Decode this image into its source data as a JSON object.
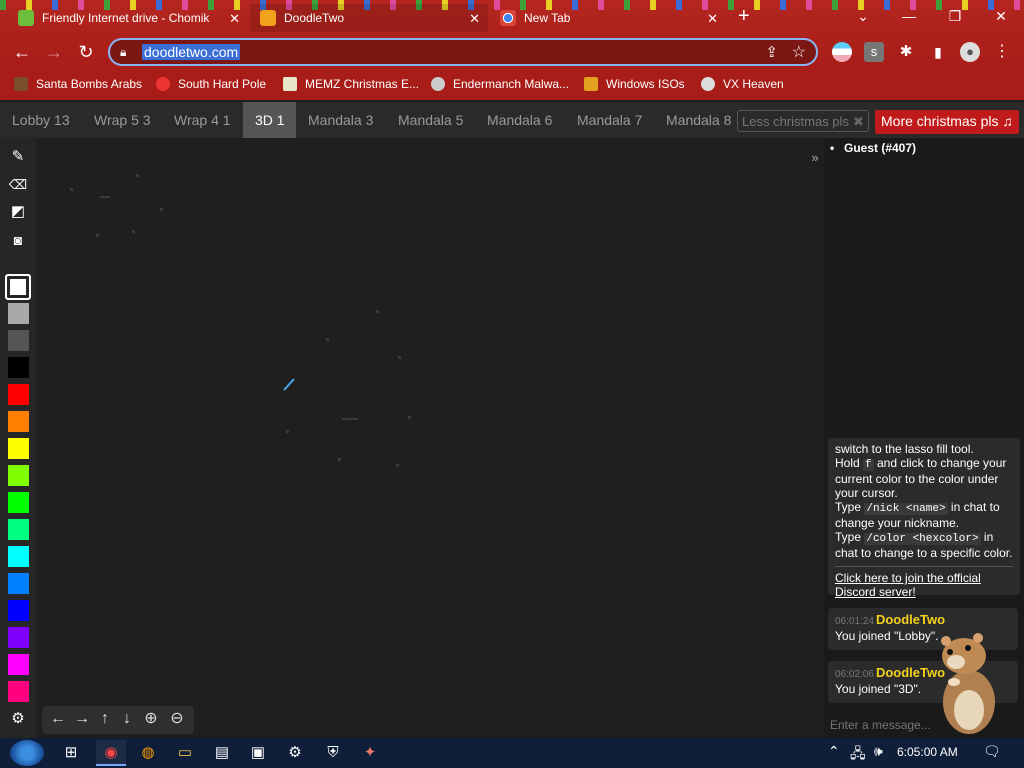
{
  "browser": {
    "tabs": [
      {
        "title": "Friendly Internet drive - Chomik",
        "active": false
      },
      {
        "title": "DoodleTwo",
        "active": true
      },
      {
        "title": "New Tab",
        "active": false
      }
    ],
    "url": "doodletwo.com",
    "bookmarks": [
      {
        "label": "Santa Bombs Arabs"
      },
      {
        "label": "South Hard Pole"
      },
      {
        "label": "MEMZ Christmas E..."
      },
      {
        "label": "Endermanch Malwa..."
      },
      {
        "label": "Windows ISOs"
      },
      {
        "label": "VX Heaven"
      }
    ],
    "extension_s_label": "s"
  },
  "rooms": [
    {
      "label": "Lobby 13",
      "active": false
    },
    {
      "label": "Wrap 5 3",
      "active": false
    },
    {
      "label": "Wrap 4 1",
      "active": false
    },
    {
      "label": "3D 1",
      "active": true
    },
    {
      "label": "Mandala 3",
      "active": false
    },
    {
      "label": "Mandala 5",
      "active": false
    },
    {
      "label": "Mandala 6",
      "active": false
    },
    {
      "label": "Mandala 7",
      "active": false
    },
    {
      "label": "Mandala 8",
      "active": false
    }
  ],
  "room_input_placeholder": "Less christmas pls",
  "more_christmas_label": "More christmas pls ♫",
  "palette": {
    "colors": [
      "#ffffff",
      "#a9a9a9",
      "#555555",
      "#000000",
      "#ff0000",
      "#ff7f00",
      "#ffff00",
      "#80ff00",
      "#00ff00",
      "#00ff80",
      "#00ffff",
      "#0080ff",
      "#0000ff",
      "#8000ff",
      "#ff00ff",
      "#ff0080"
    ],
    "selected": "#ffffff"
  },
  "users": [
    {
      "name": "Guest (#407)"
    }
  ],
  "help": {
    "line1": "switch to the lasso fill tool.",
    "hold_pre": "Hold",
    "hold_key": "f",
    "hold_post": "and click to change your current color to the color under your cursor.",
    "nick_pre": "Type",
    "nick_code": "/nick <name>",
    "nick_post": "in chat to change your nickname.",
    "color_pre": "Type",
    "color_code": "/color <hexcolor>",
    "color_post": "in chat to change to a specific color.",
    "discord_link": "Click here to join the official Discord server!"
  },
  "messages": [
    {
      "time": "06:01:24",
      "name": "DoodleTwo",
      "text": "You joined \"Lobby\"."
    },
    {
      "time": "06:02:06",
      "name": "DoodleTwo",
      "text": "You joined \"3D\"."
    }
  ],
  "chat_placeholder": "Enter a message...",
  "taskbar": {
    "clock": "6:05:00 AM"
  }
}
